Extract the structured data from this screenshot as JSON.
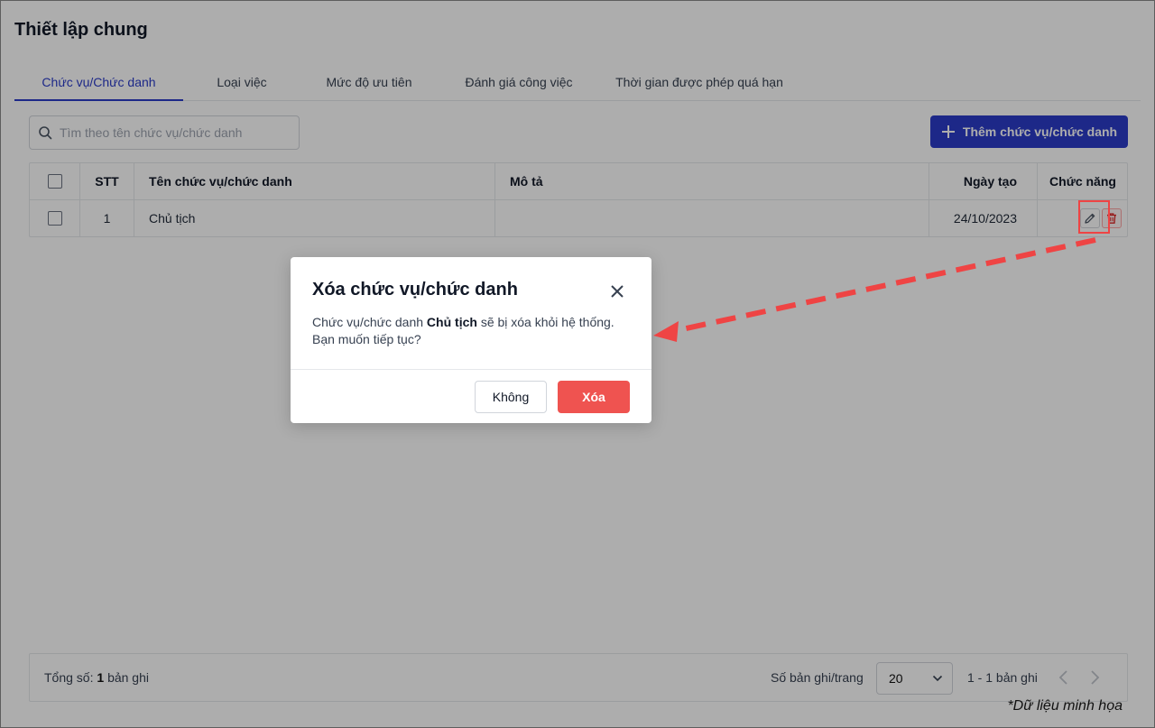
{
  "page": {
    "title": "Thiết lập chung"
  },
  "tabs": [
    {
      "label": "Chức vụ/Chức danh",
      "active": true
    },
    {
      "label": "Loại việc"
    },
    {
      "label": "Mức độ ưu tiên"
    },
    {
      "label": "Đánh giá công việc"
    },
    {
      "label": "Thời gian được phép quá hạn"
    }
  ],
  "search": {
    "placeholder": "Tìm theo tên chức vụ/chức danh"
  },
  "toolbar": {
    "add_label": "Thêm chức vụ/chức danh"
  },
  "table": {
    "headers": {
      "stt": "STT",
      "name": "Tên chức vụ/chức danh",
      "desc": "Mô tả",
      "date": "Ngày tạo",
      "actions": "Chức năng"
    },
    "rows": [
      {
        "stt": "1",
        "name": "Chủ tịch",
        "desc": "",
        "date": "24/10/2023"
      }
    ]
  },
  "footer": {
    "total_prefix": "Tổng số:",
    "total_count": "1",
    "total_suffix": "bản ghi",
    "per_page_label": "Số bản ghi/trang",
    "per_page_value": "20",
    "range": "1 - 1 bản ghi"
  },
  "modal": {
    "title": "Xóa chức vụ/chức danh",
    "body_prefix": "Chức vụ/chức danh",
    "body_name": "Chủ tịch",
    "body_suffix": "sẽ bị xóa khỏi hệ thống.",
    "body_line2": "Bạn muốn tiếp tục?",
    "cancel_label": "Không",
    "confirm_label": "Xóa"
  },
  "watermark": "*Dữ liệu minh họa",
  "colors": {
    "primary": "#2b3cc9",
    "danger": "#ef5350",
    "annotation": "#ef4444"
  },
  "icons": [
    "search-icon",
    "plus-icon",
    "edit-icon",
    "trash-icon",
    "close-icon",
    "chevron-down-icon",
    "chevron-left-icon",
    "chevron-right-icon"
  ]
}
